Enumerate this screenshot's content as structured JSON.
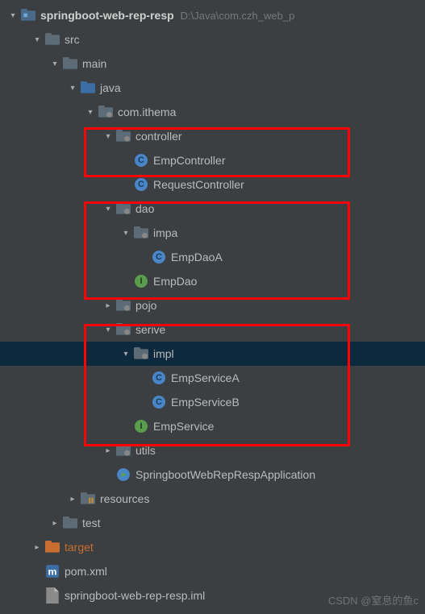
{
  "root": {
    "name": "springboot-web-rep-resp",
    "path": "D:\\Java\\com.czh_web_p"
  },
  "tree": {
    "src": "src",
    "main": "main",
    "java": "java",
    "package": "com.ithema",
    "controller": "controller",
    "empController": "EmpController",
    "requestController": "RequestController",
    "dao": "dao",
    "impa": "impa",
    "empDaoA": "EmpDaoA",
    "empDao": "EmpDao",
    "pojo": "pojo",
    "serive": "serive",
    "impl": "impl",
    "empServiceA": "EmpServiceA",
    "empServiceB": "EmpServiceB",
    "empService": "EmpService",
    "utils": "utils",
    "application": "SpringbootWebRepRespApplication",
    "resources": "resources",
    "test": "test",
    "target": "target",
    "pom": "pom.xml",
    "iml": "springboot-web-rep-resp.iml"
  },
  "watermark": "CSDN @窒息的鱼c"
}
